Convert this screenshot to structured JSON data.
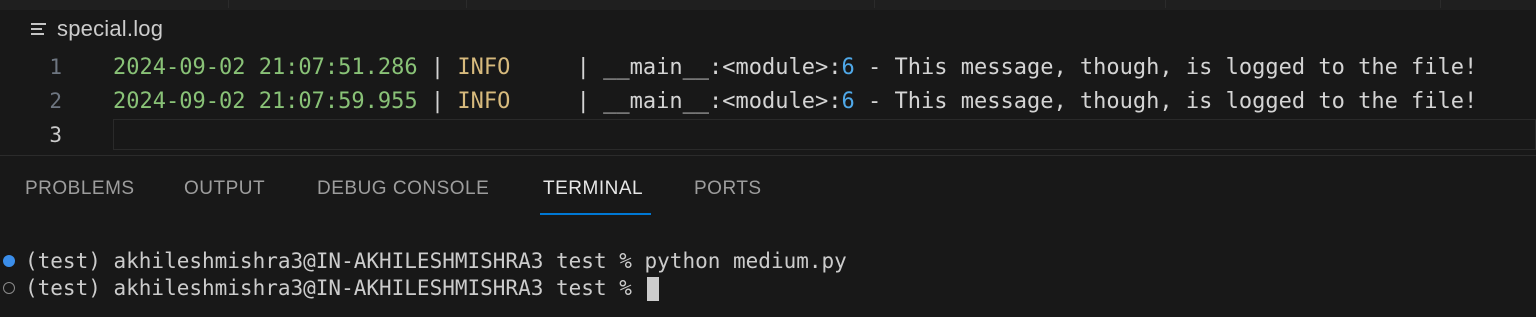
{
  "editor": {
    "file_name": "special.log",
    "lines": [
      {
        "number": "1",
        "date": "2024-09-02 21:07:51.286",
        "sep1": " | ",
        "level": "INFO",
        "pad": "     | ",
        "location": "__main__:<module>:",
        "lineno": "6",
        "message": " - This message, though, is logged to the file!"
      },
      {
        "number": "2",
        "date": "2024-09-02 21:07:59.955",
        "sep1": " | ",
        "level": "INFO",
        "pad": "     | ",
        "location": "__main__:<module>:",
        "lineno": "6",
        "message": " - This message, though, is logged to the file!"
      },
      {
        "number": "3"
      }
    ]
  },
  "panel": {
    "tabs": [
      {
        "label": "PROBLEMS"
      },
      {
        "label": "OUTPUT"
      },
      {
        "label": "DEBUG CONSOLE"
      },
      {
        "label": "TERMINAL",
        "active": true
      },
      {
        "label": "PORTS"
      }
    ]
  },
  "terminal": {
    "lines": [
      {
        "status": "success",
        "text": "(test) akhileshmishra3@IN-AKHILESHMISHRA3 test % python medium.py"
      },
      {
        "status": "pending",
        "text": "(test) akhileshmishra3@IN-AKHILESHMISHRA3 test % "
      }
    ]
  },
  "colors": {
    "background": "#181818",
    "accent": "#0078d4",
    "date": "#89c277",
    "number": "#4fa8e8",
    "status_dot": "#3b8eea"
  },
  "icons": {
    "file": "list-lines-icon",
    "terminal_success": "filled-circle-icon",
    "terminal_pending": "hollow-circle-icon"
  }
}
